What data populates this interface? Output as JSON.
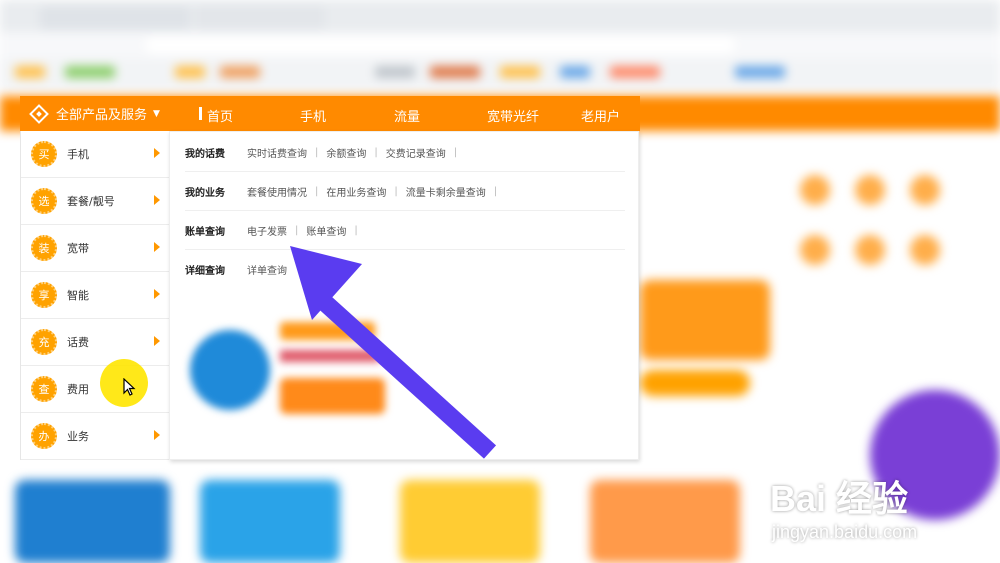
{
  "nav": {
    "category_label": "全部产品及服务",
    "items": [
      "首页",
      "手机",
      "流量",
      "宽带光纤",
      "老用户"
    ]
  },
  "sidebar": {
    "items": [
      {
        "badge": "买",
        "label": "手机"
      },
      {
        "badge": "选",
        "label": "套餐/靓号"
      },
      {
        "badge": "装",
        "label": "宽带"
      },
      {
        "badge": "享",
        "label": "智能"
      },
      {
        "badge": "充",
        "label": "话费"
      },
      {
        "badge": "查",
        "label": "费用"
      },
      {
        "badge": "办",
        "label": "业务"
      }
    ]
  },
  "dropdown": {
    "rows": [
      {
        "category": "我的话费",
        "links": [
          "实时话费查询",
          "余额查询",
          "交费记录查询"
        ]
      },
      {
        "category": "我的业务",
        "links": [
          "套餐使用情况",
          "在用业务查询",
          "流量卡剩余量查询"
        ]
      },
      {
        "category": "账单查询",
        "links": [
          "电子发票",
          "账单查询"
        ]
      },
      {
        "category": "详细查询",
        "links": [
          "详单查询"
        ]
      }
    ]
  },
  "watermark": {
    "brand": "Bai 经验",
    "url": "jingyan.baidu.com"
  },
  "colors": {
    "brand_orange": "#ff8a00",
    "badge_orange": "#ffa200",
    "arrow_purple": "#5a3cf0",
    "cursor_highlight": "#ffe600"
  }
}
